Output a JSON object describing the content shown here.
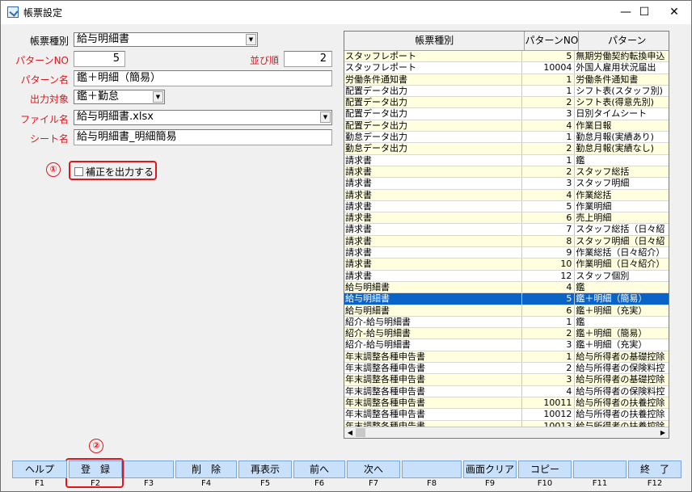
{
  "window": {
    "title": "帳票設定",
    "minimize": "—",
    "maximize": "☐",
    "close": "✕"
  },
  "form": {
    "report_type_label": "帳票種別",
    "report_type_value": "給与明細書",
    "pattern_no_label": "パターンNO",
    "pattern_no_value": "5",
    "sort_order_label": "並び順",
    "sort_order_value": "2",
    "pattern_name_label": "パターン名",
    "pattern_name_value": "鑑＋明細（簡易）",
    "output_target_label": "出力対象",
    "output_target_value": "鑑＋勤怠",
    "file_name_label": "ファイル名",
    "file_name_value": "給与明細書.xlsx",
    "sheet_name_label": "シート名",
    "sheet_name_value": "給与明細書_明細簡易",
    "checkbox_label": "補正を出力する",
    "marker1": "①",
    "marker2": "②"
  },
  "grid": {
    "columns": [
      "帳票種別",
      "パターンNO",
      "パターン"
    ],
    "rows": [
      [
        "スタッフレポート",
        "5",
        "無期労働契約転換申込"
      ],
      [
        "スタッフレポート",
        "10004",
        "外国人雇用状況届出"
      ],
      [
        "労働条件通知書",
        "1",
        "労働条件通知書"
      ],
      [
        "配置データ出力",
        "1",
        "シフト表(スタッフ別)"
      ],
      [
        "配置データ出力",
        "2",
        "シフト表(得意先別)"
      ],
      [
        "配置データ出力",
        "3",
        "日別タイムシート"
      ],
      [
        "配置データ出力",
        "4",
        "作業日報"
      ],
      [
        "勤怠データ出力",
        "1",
        "勤怠月報(実績あり)"
      ],
      [
        "勤怠データ出力",
        "2",
        "勤怠月報(実績なし)"
      ],
      [
        "請求書",
        "1",
        "鑑"
      ],
      [
        "請求書",
        "2",
        "スタッフ総括"
      ],
      [
        "請求書",
        "3",
        "スタッフ明細"
      ],
      [
        "請求書",
        "4",
        "作業総括"
      ],
      [
        "請求書",
        "5",
        "作業明細"
      ],
      [
        "請求書",
        "6",
        "売上明細"
      ],
      [
        "請求書",
        "7",
        "スタッフ総括（日々紹"
      ],
      [
        "請求書",
        "8",
        "スタッフ明細（日々紹"
      ],
      [
        "請求書",
        "9",
        "作業総括（日々紹介）"
      ],
      [
        "請求書",
        "10",
        "作業明細（日々紹介）"
      ],
      [
        "請求書",
        "12",
        "スタッフ個別"
      ],
      [
        "給与明細書",
        "4",
        "鑑"
      ],
      [
        "給与明細書",
        "5",
        "鑑＋明細（簡易）"
      ],
      [
        "給与明細書",
        "6",
        "鑑＋明細（充実）"
      ],
      [
        "紹介-給与明細書",
        "1",
        "鑑"
      ],
      [
        "紹介-給与明細書",
        "2",
        "鑑＋明細（簡易）"
      ],
      [
        "紹介-給与明細書",
        "3",
        "鑑＋明細（充実）"
      ],
      [
        "年末調整各種申告書",
        "1",
        "給与所得者の基礎控除"
      ],
      [
        "年末調整各種申告書",
        "2",
        "給与所得者の保険料控"
      ],
      [
        "年末調整各種申告書",
        "3",
        "給与所得者の基礎控除"
      ],
      [
        "年末調整各種申告書",
        "4",
        "給与所得者の保険料控"
      ],
      [
        "年末調整各種申告書",
        "10011",
        "給与所得者の扶養控除"
      ],
      [
        "年末調整各種申告書",
        "10012",
        "給与所得者の扶養控除"
      ],
      [
        "年末調整各種申告書",
        "10013",
        "給与所得者の扶養控除"
      ]
    ],
    "selected_index": 21
  },
  "fkeys": [
    {
      "label": "ヘルプ",
      "key": "F1"
    },
    {
      "label": "登　録",
      "key": "F2"
    },
    {
      "label": "",
      "key": "F3"
    },
    {
      "label": "削　除",
      "key": "F4"
    },
    {
      "label": "再表示",
      "key": "F5"
    },
    {
      "label": "前へ",
      "key": "F6"
    },
    {
      "label": "次へ",
      "key": "F7"
    },
    {
      "label": "",
      "key": "F8"
    },
    {
      "label": "画面クリア",
      "key": "F9"
    },
    {
      "label": "コピー",
      "key": "F10"
    },
    {
      "label": "",
      "key": "F11"
    },
    {
      "label": "終　了",
      "key": "F12"
    }
  ],
  "colors": {
    "accent_red": "#e0161d",
    "selected_row": "#0a64c8",
    "alt_row": "#ffffe0",
    "fkey_bg": "#c8e0fa"
  }
}
